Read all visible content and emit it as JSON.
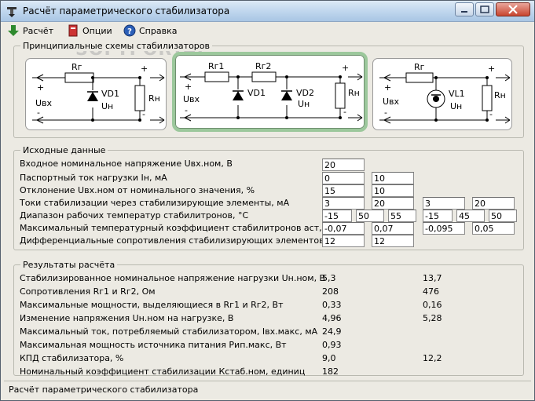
{
  "window": {
    "title": "Расчёт параметрического стабилизатора",
    "icon": "stabilizer-app-icon"
  },
  "toolbar": {
    "calc_label": "Расчёт",
    "options_label": "Опции",
    "help_label": "Справка",
    "watermark": "SOFTPORTAL"
  },
  "schemes": {
    "title": "Принципиальные схемы стабилизаторов",
    "selected": 2,
    "s1": {
      "r": "Rг",
      "d": "VD1",
      "uh": "Uн",
      "load": "Rн",
      "uin": "Uвх",
      "plus": "+",
      "minus": "-"
    },
    "s2": {
      "r1": "Rг1",
      "r2": "Rг2",
      "d1": "VD1",
      "d2": "VD2",
      "uh": "Uн",
      "load": "Rн",
      "uin": "Uвх",
      "plus": "+",
      "minus": "-"
    },
    "s3": {
      "r": "Rг",
      "d": "VL1",
      "uh": "Uн",
      "load": "Rн",
      "uin": "Uвх",
      "plus": "+",
      "minus": "-"
    }
  },
  "inputs": {
    "title": "Исходные данные",
    "rows": [
      {
        "label": "Входное номинальное напряжение Uвх.ном, В",
        "values": [
          "20"
        ]
      },
      {
        "label": "Паспортный ток нагрузки Iн, мА",
        "values": [
          "0",
          "10"
        ]
      },
      {
        "label": "Отклонение Uвх.ном от номинального значения, %",
        "values": [
          "15",
          "10"
        ]
      },
      {
        "label": "Токи стабилизации через стабилизирующие элементы, мА",
        "values": [
          "3",
          "20",
          "3",
          "20"
        ]
      },
      {
        "label": "Диапазон рабочих температур стабилитронов, °С",
        "values": [
          "-15",
          "50",
          "55",
          "-15",
          "45",
          "50"
        ]
      },
      {
        "label": "Максимальный температурный коэффициент стабилитронов аст, %/°С",
        "values": [
          "-0,07",
          "0,07",
          "-0,095",
          "0,05"
        ]
      },
      {
        "label": "Дифференциальные сопротивления стабилизирующих элементов, Ом",
        "values": [
          "12",
          "12"
        ]
      }
    ]
  },
  "results": {
    "title": "Результаты расчёта",
    "rows": [
      {
        "label": "Стабилизированное номинальное напряжение нагрузки Uн.ном, В",
        "v1": "5,3",
        "v2": "13,7"
      },
      {
        "label": "Сопротивления Rг1 и Rг2, Ом",
        "v1": "208",
        "v2": "476"
      },
      {
        "label": "Максимальные мощности, выделяющиеся в Rг1 и Rг2, Вт",
        "v1": "0,33",
        "v2": "0,16"
      },
      {
        "label": "Изменение напряжения Uн.ном на нагрузке, В",
        "v1": "4,96",
        "v2": "5,28"
      },
      {
        "label": "Максимальный ток, потребляемый стабилизатором, Iвх.макс, мА",
        "v1": "24,9",
        "v2": ""
      },
      {
        "label": "Максимальная мощность источника питания Рип.макс, Вт",
        "v1": "0,93",
        "v2": ""
      },
      {
        "label": "КПД стабилизатора, %",
        "v1": "9,0",
        "v2": "12,2"
      },
      {
        "label": "Номинальный коэффициент стабилизации Кстаб.ном, единиц",
        "v1": "182",
        "v2": ""
      }
    ]
  },
  "status": {
    "text": "Расчёт параметрического стабилизатора"
  }
}
